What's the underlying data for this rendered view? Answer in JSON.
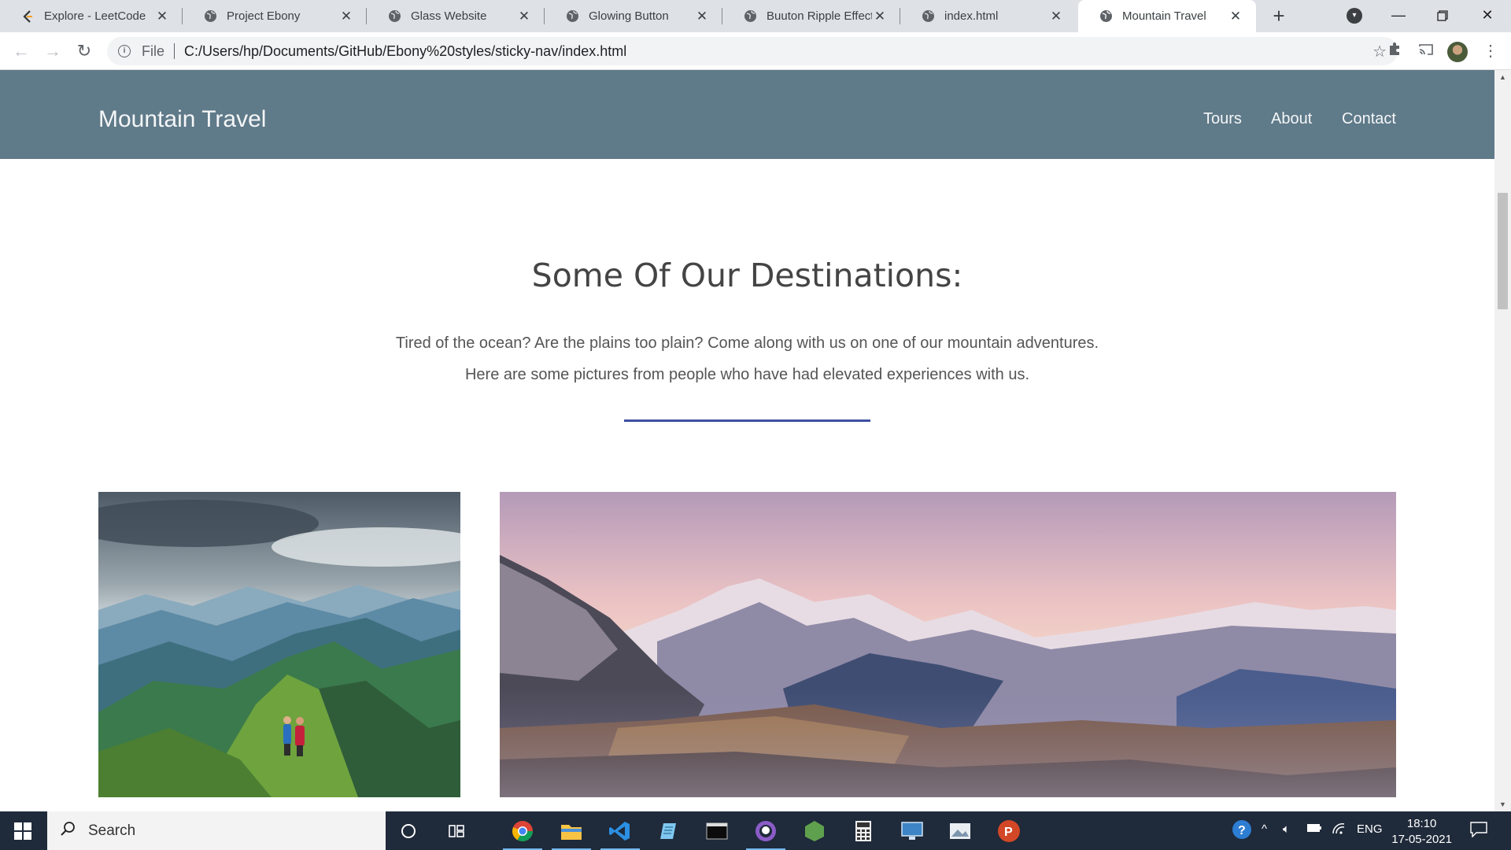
{
  "browser": {
    "tabs": [
      {
        "label": "Explore - LeetCode",
        "icon": "leetcode-icon",
        "active": false
      },
      {
        "label": "Project Ebony",
        "icon": "globe-icon",
        "active": false
      },
      {
        "label": "Glass Website",
        "icon": "globe-icon",
        "active": false
      },
      {
        "label": "Glowing Button",
        "icon": "globe-icon",
        "active": false
      },
      {
        "label": "Buuton Ripple Effect",
        "icon": "globe-icon",
        "active": false
      },
      {
        "label": "index.html",
        "icon": "globe-icon",
        "active": false
      },
      {
        "label": "Mountain Travel",
        "icon": "globe-icon",
        "active": true
      }
    ],
    "close_glyph": "✕",
    "new_tab_glyph": "+",
    "address": {
      "scheme_label": "File",
      "url": "C:/Users/hp/Documents/GitHub/Ebony%20styles/sticky-nav/index.html"
    }
  },
  "site": {
    "logo": "Mountain Travel",
    "nav": [
      "Tours",
      "About",
      "Contact"
    ],
    "nav_color": "#5f7a89",
    "heading": "Some Of Our Destinations:",
    "paragraph_lines": [
      "Tired of the ocean? Are the plains too plain? Come along with us on one of our mountain adventures.",
      "Here are some pictures from people who have had elevated experiences with us."
    ],
    "divider_color": "#3d4fa3",
    "photos": [
      "hikers-on-green-ridge-photo",
      "alpine-sunrise-valley-photo"
    ]
  },
  "taskbar": {
    "search_placeholder": "Search",
    "apps": [
      "cortana-icon",
      "task-view-icon",
      "chrome-icon",
      "file-explorer-icon",
      "vscode-icon",
      "notepad-icon",
      "terminal-icon",
      "github-desktop-icon",
      "nodejs-icon",
      "calculator-icon",
      "remote-desktop-icon",
      "photos-icon",
      "powerpoint-icon"
    ],
    "language": "ENG",
    "time": "18:10",
    "date": "17-05-2021"
  }
}
